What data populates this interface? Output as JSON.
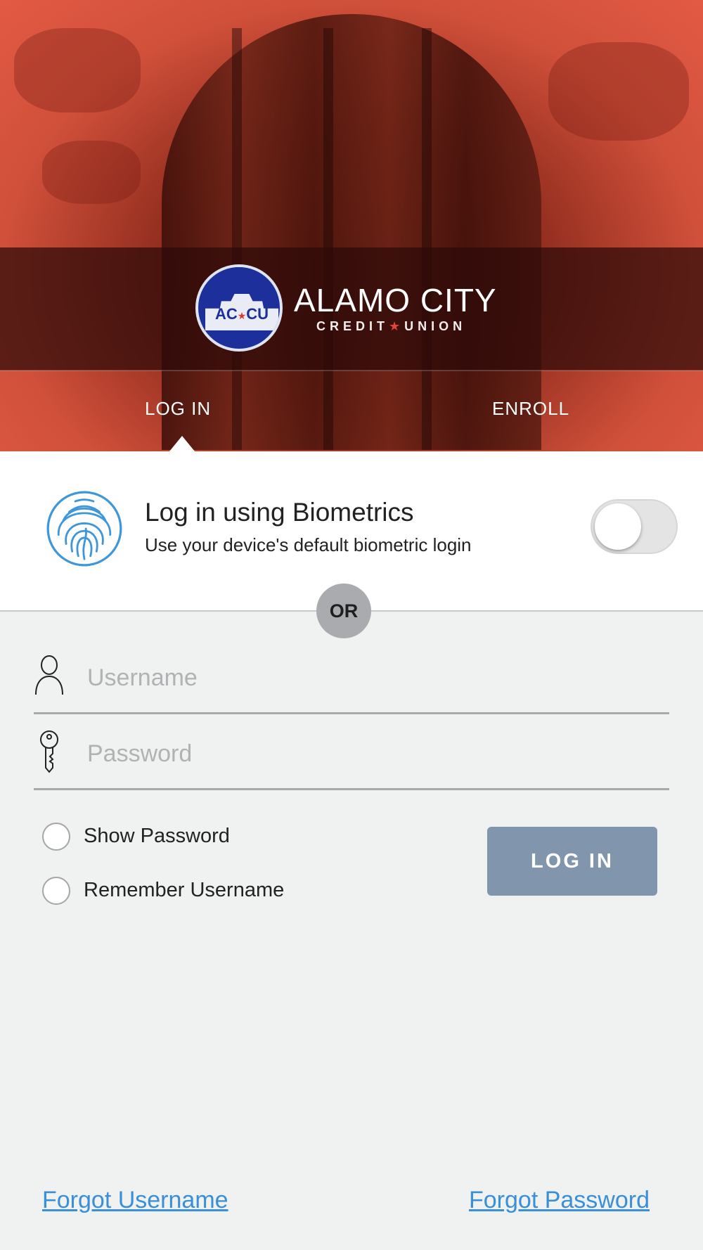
{
  "brand": {
    "seal_text_left": "AC",
    "seal_text_right": "CU",
    "name": "ALAMO CITY",
    "sub_left": "CREDIT",
    "sub_right": "UNION"
  },
  "tabs": [
    {
      "label": "LOG IN",
      "active": true
    },
    {
      "label": "ENROLL",
      "active": false
    }
  ],
  "biometrics": {
    "title": "Log in using Biometrics",
    "description": "Use your device's default biometric login",
    "enabled": false
  },
  "divider": {
    "label": "OR"
  },
  "form": {
    "username": {
      "value": "",
      "placeholder": "Username"
    },
    "password": {
      "value": "",
      "placeholder": "Password"
    },
    "show_password": {
      "label": "Show Password",
      "checked": false
    },
    "remember_username": {
      "label": "Remember Username",
      "checked": false
    },
    "submit_label": "LOG IN"
  },
  "links": {
    "forgot_username": "Forgot Username",
    "forgot_password": "Forgot Password"
  },
  "colors": {
    "hero_red": "#e35a44",
    "seal_blue": "#1c2f9a",
    "button": "#8196ad",
    "link": "#3a8fd6",
    "or_badge": "#a9abae"
  },
  "icons": {
    "biometrics": "fingerprint-icon",
    "username": "user-icon",
    "password": "key-icon"
  }
}
